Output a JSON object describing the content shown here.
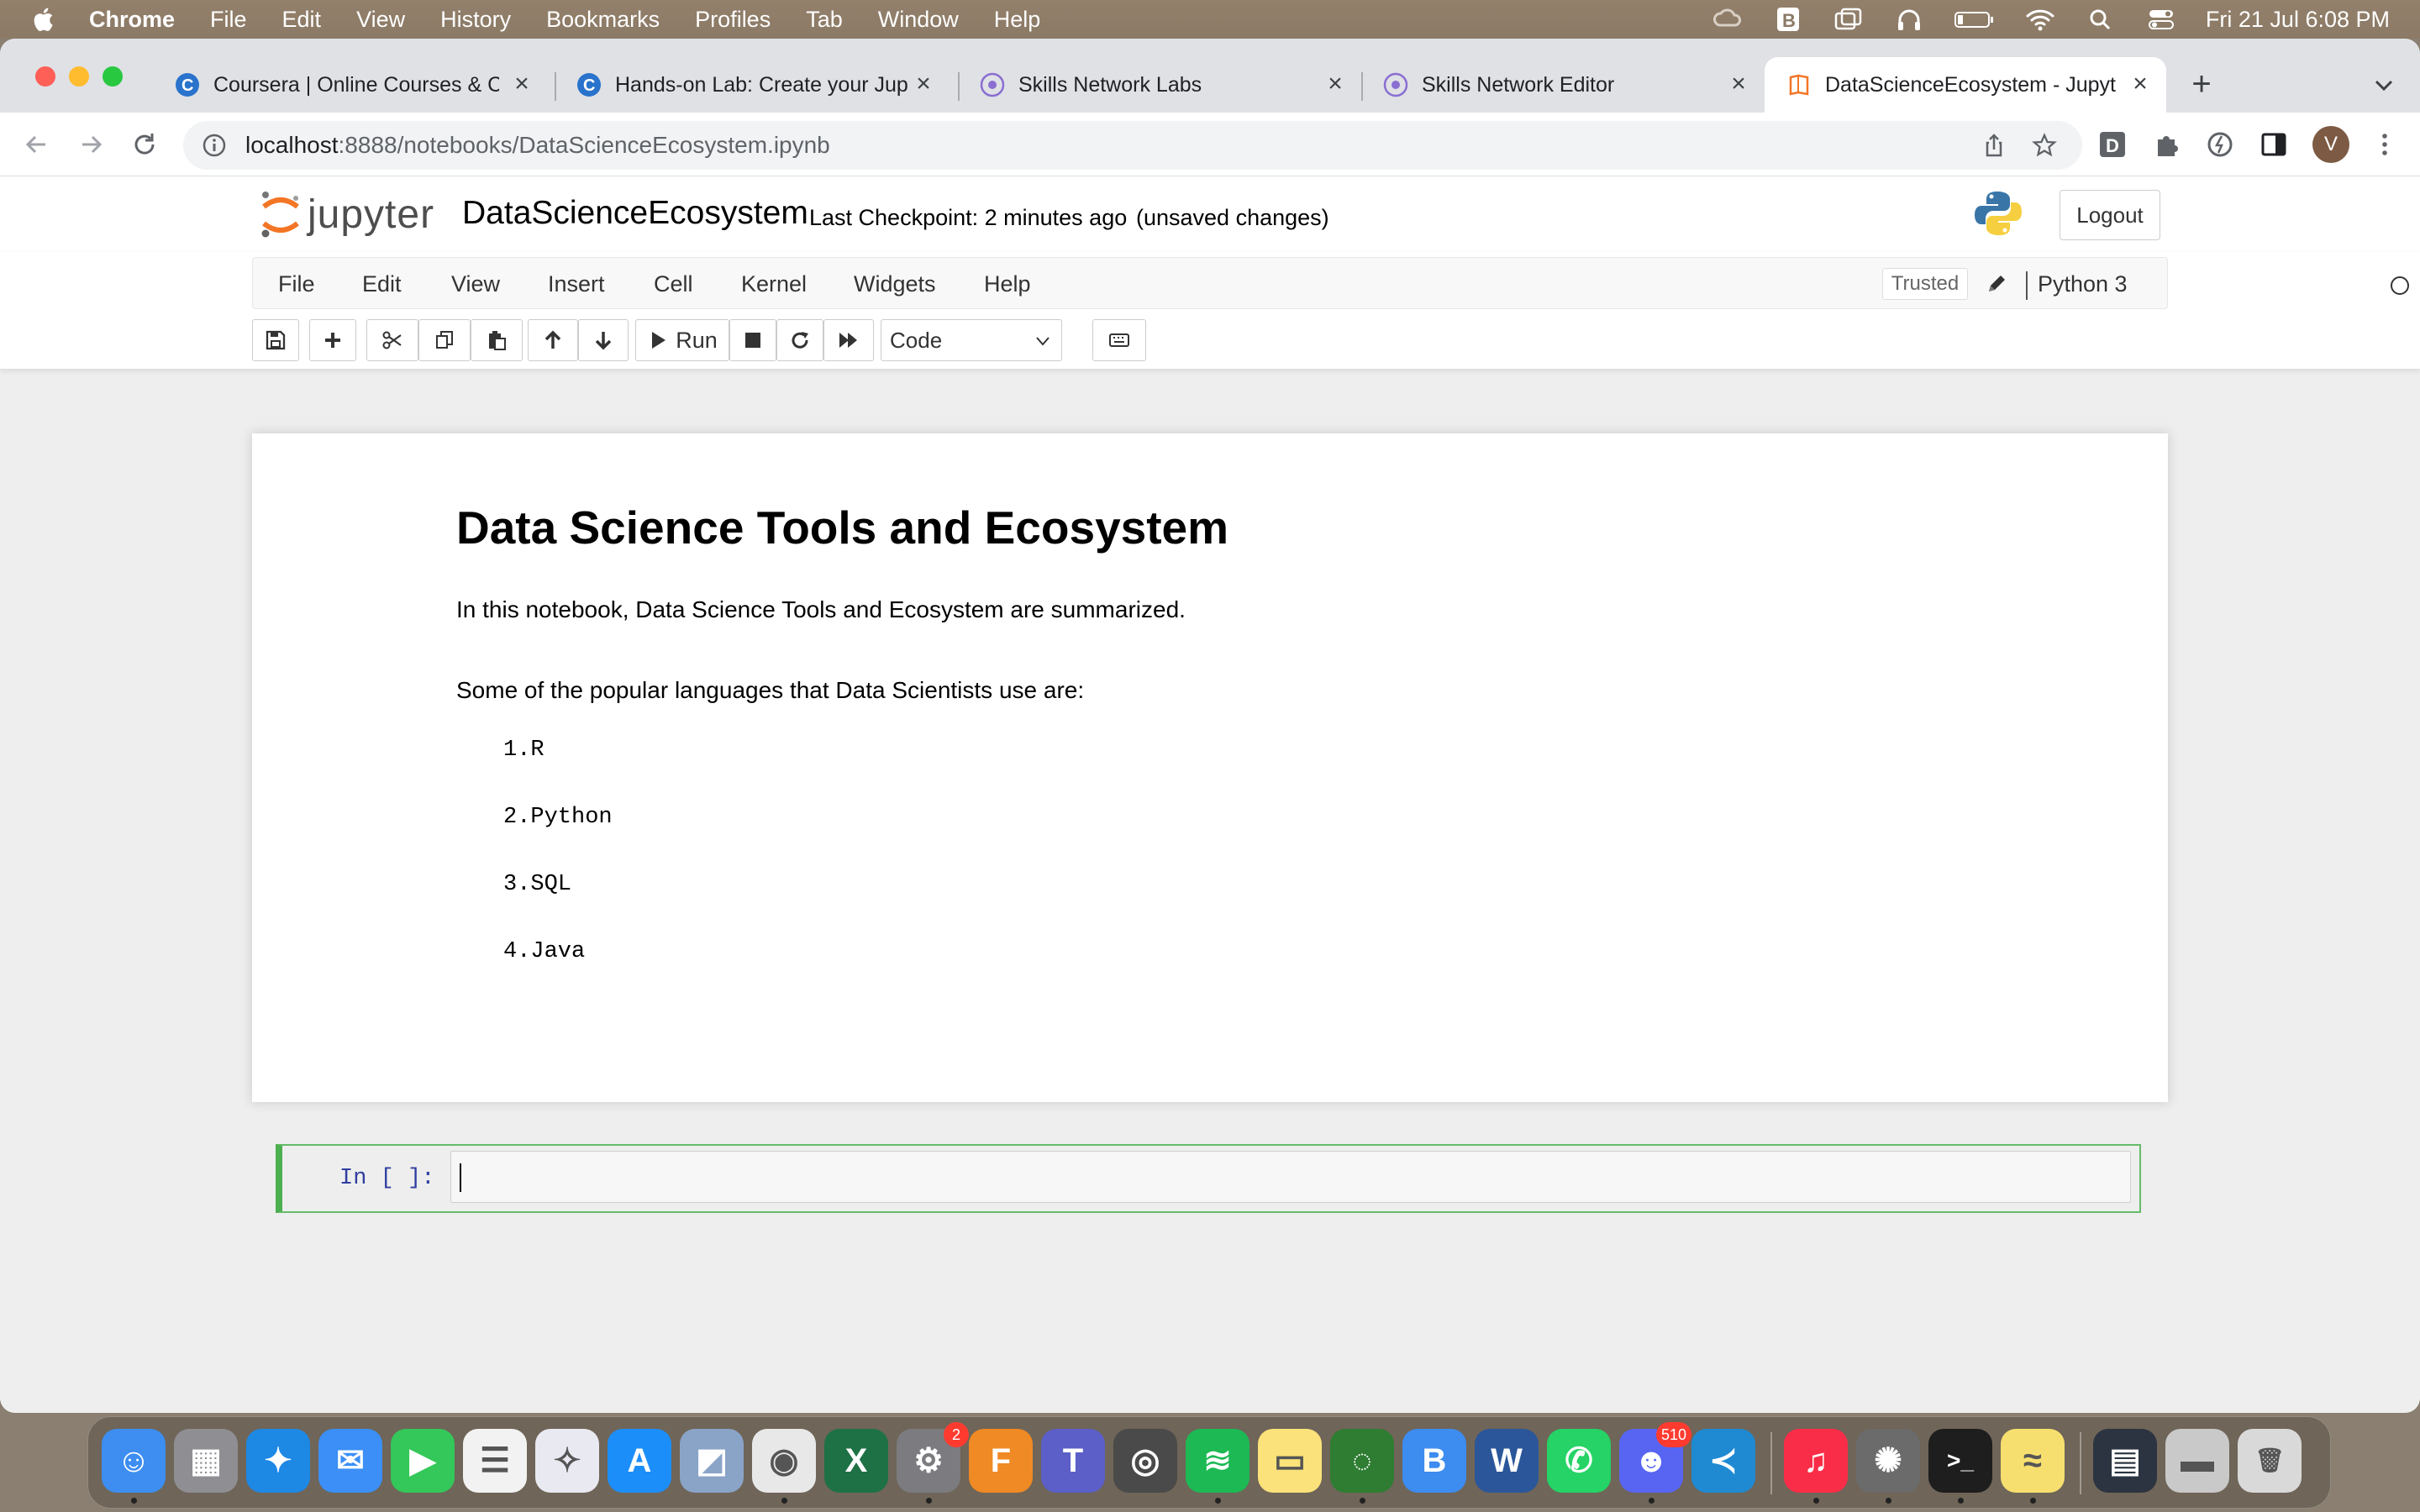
{
  "menubar": {
    "app": "Chrome",
    "items": [
      "File",
      "Edit",
      "View",
      "History",
      "Bookmarks",
      "Profiles",
      "Tab",
      "Window",
      "Help"
    ],
    "clock": "Fri 21 Jul  6:08 PM"
  },
  "tabs": [
    {
      "title": "Coursera | Online Courses & Cr",
      "favicon": "coursera-icon",
      "color": "#2a73cc"
    },
    {
      "title": "Hands-on Lab: Create your Jup",
      "favicon": "coursera-icon",
      "color": "#2a73cc"
    },
    {
      "title": "Skills Network Labs",
      "favicon": "skills-network-icon",
      "color": "#8a6fd1"
    },
    {
      "title": "Skills Network Editor",
      "favicon": "skills-network-icon",
      "color": "#8a6fd1"
    },
    {
      "title": "DataScienceEcosystem - Jupyt",
      "favicon": "jupyter-book-icon",
      "color": "#f37626",
      "active": true
    }
  ],
  "address": {
    "host": "localhost",
    "rest": ":8888/notebooks/DataScienceEcosystem.ipynb"
  },
  "profile_initial": "V",
  "jupyter": {
    "logo_text": "jupyter",
    "notebook_name": "DataScienceEcosystem",
    "checkpoint": "Last Checkpoint: 2 minutes ago",
    "unsaved": "(unsaved changes)",
    "logout": "Logout",
    "menu": [
      "File",
      "Edit",
      "View",
      "Insert",
      "Cell",
      "Kernel",
      "Widgets",
      "Help"
    ],
    "trusted": "Trusted",
    "kernel": "Python 3",
    "run_label": "Run",
    "cell_type": "Code"
  },
  "notebook": {
    "heading": "Data Science Tools and Ecosystem",
    "intro": "In this notebook, Data Science Tools and Ecosystem are summarized.",
    "lead": "Some of the popular languages that Data Scientists use are:",
    "languages": [
      "1.R",
      "2.Python",
      "3.SQL",
      "4.Java"
    ],
    "prompt": "In [ ]:"
  },
  "dock": {
    "apps": [
      {
        "name": "finder-icon",
        "color": "#3d8ef0",
        "sym": "☺"
      },
      {
        "name": "launchpad-icon",
        "color": "#8e8e93",
        "sym": "▦"
      },
      {
        "name": "safari-icon",
        "color": "#1e88e5",
        "sym": "✦"
      },
      {
        "name": "mail-icon",
        "color": "#3b8ff6",
        "sym": "✉"
      },
      {
        "name": "facetime-icon",
        "color": "#34c759",
        "sym": "▶"
      },
      {
        "name": "reminders-icon",
        "color": "#f2f2f2",
        "sym": "☰"
      },
      {
        "name": "instruments-icon",
        "color": "#e9e9f2",
        "sym": "✧"
      },
      {
        "name": "app-store-icon",
        "color": "#1c8ef9",
        "sym": "A"
      },
      {
        "name": "preview-icon",
        "color": "#8aa4c8",
        "sym": "◩"
      },
      {
        "name": "chrome-icon",
        "color": "#e8e8e8",
        "sym": "◉"
      },
      {
        "name": "excel-icon",
        "color": "#1e7145",
        "sym": "X"
      },
      {
        "name": "system-settings-icon",
        "color": "#7b7b80",
        "sym": "⚙",
        "badge": "2"
      },
      {
        "name": "fusion-360-icon",
        "color": "#f08a24",
        "sym": "F"
      },
      {
        "name": "teams-icon",
        "color": "#5b5fc7",
        "sym": "T"
      },
      {
        "name": "blender-icon",
        "color": "#4a4a4a",
        "sym": "◎"
      },
      {
        "name": "spotify-icon",
        "color": "#1db954",
        "sym": "≋"
      },
      {
        "name": "notes-icon",
        "color": "#fbe27a",
        "sym": "▭"
      },
      {
        "name": "circle-app-icon",
        "color": "#2e7d32",
        "sym": "◌"
      },
      {
        "name": "b-app-icon",
        "color": "#3d8cf0",
        "sym": "B"
      },
      {
        "name": "word-icon",
        "color": "#2b579a",
        "sym": "W"
      },
      {
        "name": "whatsapp-icon",
        "color": "#25d366",
        "sym": "✆"
      },
      {
        "name": "discord-icon",
        "color": "#5865f2",
        "sym": "☻",
        "badge": "510"
      },
      {
        "name": "vscode-icon",
        "color": "#1f8ad2",
        "sym": "≺"
      },
      {
        "name": "music-icon",
        "color": "#fa2d48",
        "sym": "♫"
      },
      {
        "name": "spider-app-icon",
        "color": "#6b6b6b",
        "sym": "✺"
      },
      {
        "name": "terminal-icon",
        "color": "#1e1e1e",
        "sym": ">_"
      },
      {
        "name": "stickies-icon",
        "color": "#f7df6f",
        "sym": "≈"
      },
      {
        "name": "recent-window-icon",
        "color": "#2b3440",
        "sym": "▤"
      },
      {
        "name": "downloads-stack-icon",
        "color": "#c9c9c9",
        "sym": "▬"
      },
      {
        "name": "trash-icon",
        "color": "#d9d9d9",
        "sym": "🗑"
      }
    ]
  }
}
